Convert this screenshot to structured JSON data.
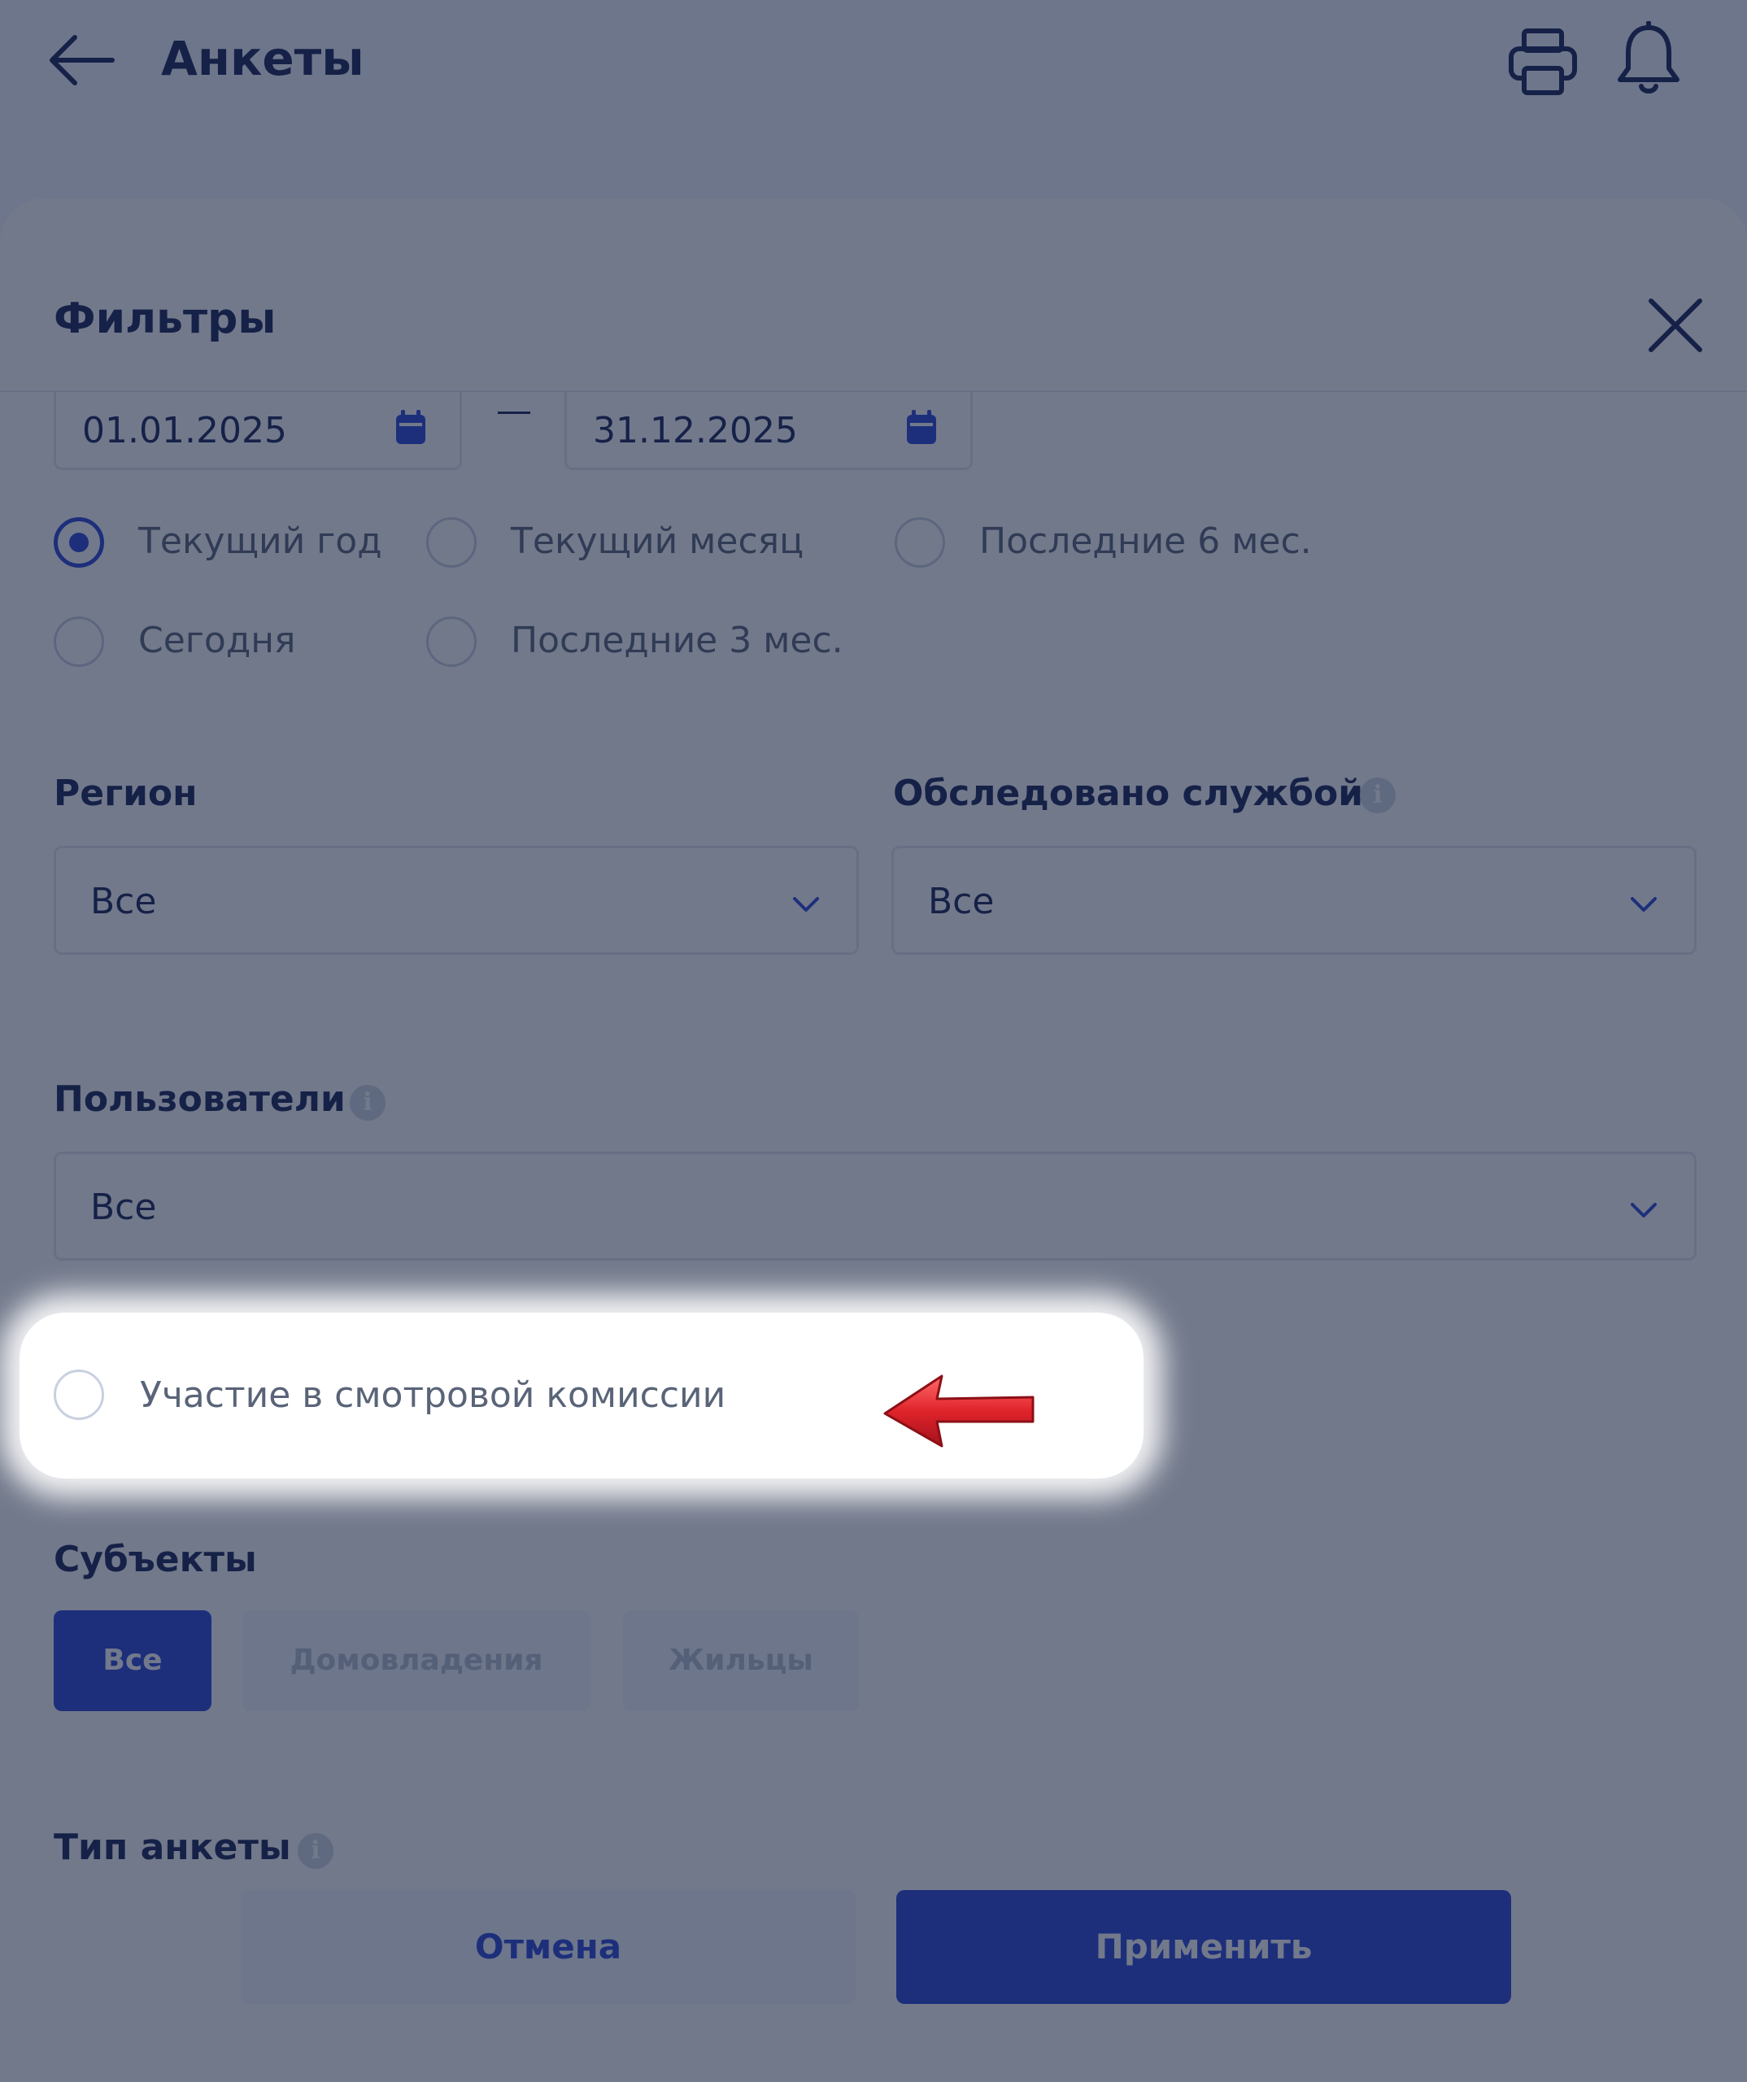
{
  "header": {
    "title": "Анкеты"
  },
  "icons": {
    "back": "arrow-left-icon",
    "print": "printer-icon",
    "notifications": "bell-icon",
    "close": "close-icon",
    "calendar": "calendar-icon",
    "chevron": "chevron-down-icon",
    "info": "info-icon",
    "pointer": "red-arrow-icon"
  },
  "sheet": {
    "title": "Фильтры"
  },
  "dates": {
    "from": "01.01.2025",
    "to": "31.12.2025"
  },
  "periods": [
    {
      "label": "Текущий год",
      "selected": true
    },
    {
      "label": "Текущий месяц",
      "selected": false
    },
    {
      "label": "Последние 6 мес.",
      "selected": false
    },
    {
      "label": "Сегодня",
      "selected": false
    },
    {
      "label": "Последние 3 мес.",
      "selected": false
    }
  ],
  "region": {
    "label": "Регион",
    "value": "Все"
  },
  "surveyed": {
    "label": "Обследовано службой",
    "value": "Все"
  },
  "users": {
    "label": "Пользователи",
    "value": "Все"
  },
  "commission": {
    "label": "Участие в смотровой комиссии",
    "checked": false
  },
  "subjects": {
    "label": "Субъекты",
    "options": [
      "Все",
      "Домовладения",
      "Жильцы"
    ],
    "active": "Все"
  },
  "form_type": {
    "label": "Тип анкеты"
  },
  "actions": {
    "cancel": "Отмена",
    "apply": "Применить"
  },
  "colors": {
    "accent": "#2b46d6",
    "text": "#1b2559",
    "overlay": "rgba(20,32,62,0.60)",
    "pointer": "#d6222a"
  }
}
